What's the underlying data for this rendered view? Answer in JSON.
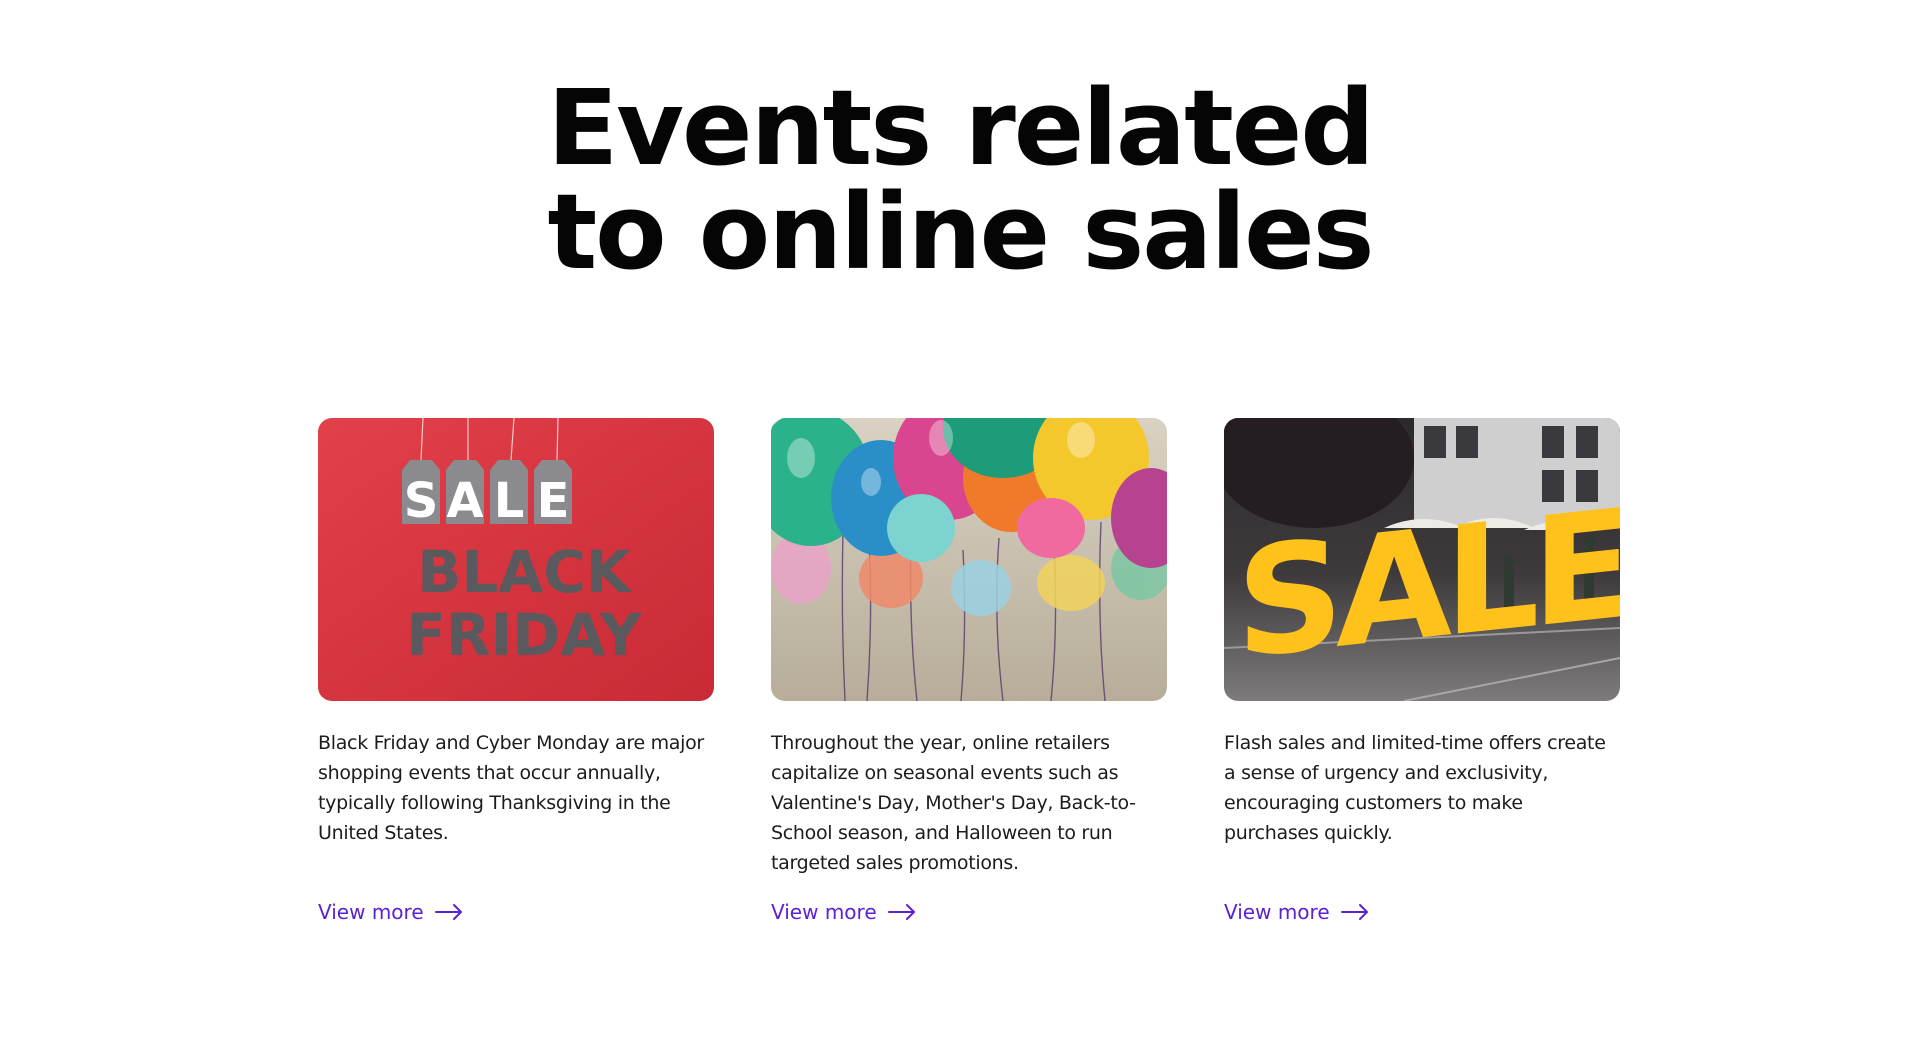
{
  "heading": {
    "line1": "Events related",
    "line2": "to online sales"
  },
  "cards": [
    {
      "image_text": {
        "tags": [
          "S",
          "A",
          "L",
          "E"
        ],
        "line1": "BLACK",
        "line2": "FRIDAY"
      },
      "description": "Black Friday and Cyber Monday are major shopping events that occur annually, typically following Thanksgiving in the United States.",
      "link_label": "View more"
    },
    {
      "description": "Throughout the year, online retailers capitalize on seasonal events such as Valentine's Day, Mother's Day, Back-to-School season, and Halloween to run targeted sales promotions.",
      "link_label": "View more"
    },
    {
      "image_text": {
        "word": "SALE"
      },
      "description": "Flash sales and limited-time offers create a sense of urgency and exclusivity, encouraging customers to make purchases quickly.",
      "link_label": "View more"
    }
  ],
  "colors": {
    "link": "#5b21d6",
    "heading": "#050505",
    "black_friday_bg": "#d9343f",
    "sale_yellow": "#ffc21a"
  }
}
